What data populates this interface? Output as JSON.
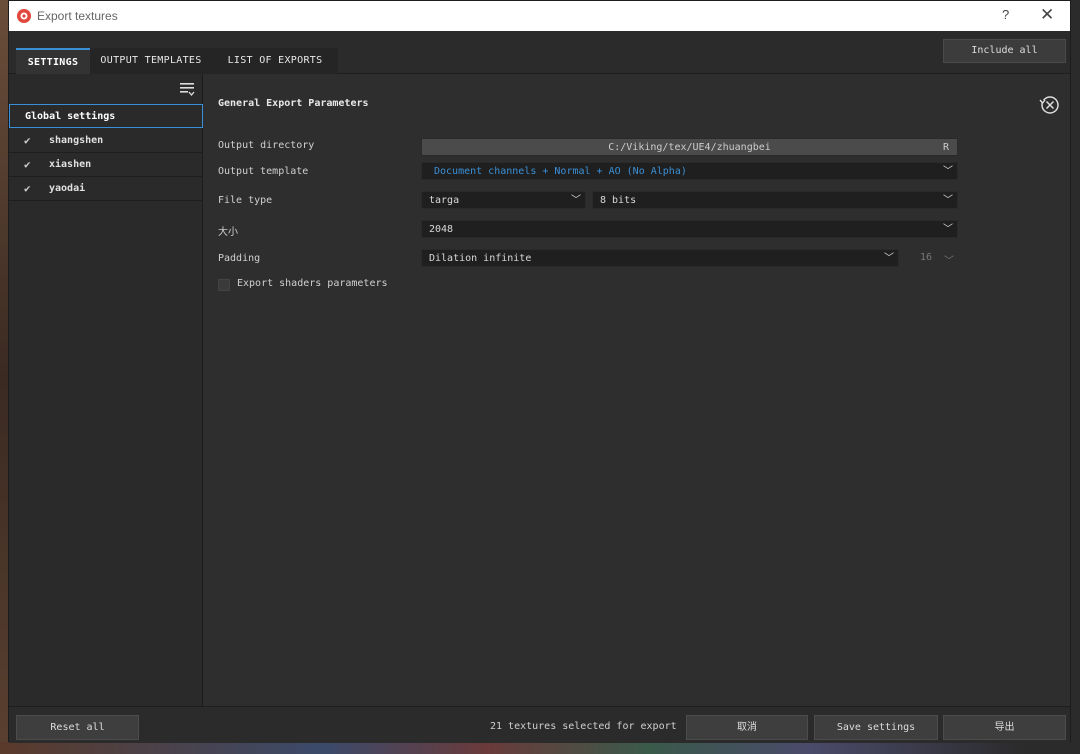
{
  "window": {
    "title": "Export textures",
    "help_label": "?",
    "close_label": "✕"
  },
  "tabs": [
    {
      "label": "SETTINGS"
    },
    {
      "label": "OUTPUT TEMPLATES"
    },
    {
      "label": "LIST OF EXPORTS"
    }
  ],
  "include_all_label": "Include all",
  "sidebar": {
    "items": [
      {
        "label": "Global settings"
      },
      {
        "label": "shangshen",
        "checked": true
      },
      {
        "label": "xiashen",
        "checked": true
      },
      {
        "label": "yaodai",
        "checked": true
      }
    ]
  },
  "main": {
    "section_title": "General Export Parameters",
    "output_directory": {
      "label": "Output directory",
      "value": "C:/Viking/tex/UE4/zhuangbei",
      "suffix": "R"
    },
    "output_template": {
      "label": "Output template",
      "value": "Document channels + Normal + AO (No Alpha)"
    },
    "file_type": {
      "label": "File type",
      "format": "targa",
      "bits": "8 bits"
    },
    "size": {
      "label": "大小",
      "value": "2048"
    },
    "padding": {
      "label": "Padding",
      "value": "Dilation infinite",
      "amount": "16"
    },
    "export_shaders": {
      "label": "Export shaders parameters",
      "checked": false
    }
  },
  "footer": {
    "reset_label": "Reset all",
    "status": "21 textures selected for export",
    "cancel_label": "取消",
    "save_label": "Save settings",
    "export_label": "导出"
  },
  "colors": {
    "accent": "#3a8fd6",
    "panel": "#2e2e2e",
    "field": "#1f1f1f"
  }
}
